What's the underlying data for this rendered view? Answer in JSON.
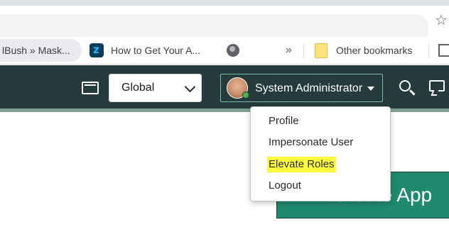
{
  "browser": {
    "bookmarks": [
      {
        "label": "lBush » Mask..."
      },
      {
        "label": "How to Get Your A..."
      },
      {
        "label": ""
      }
    ],
    "more_label": "»",
    "other_bookmarks_label": "Other bookmarks"
  },
  "header": {
    "scope_select_value": "Global",
    "user_name": "System Administrator"
  },
  "user_menu": {
    "items": [
      {
        "label": "Profile",
        "highlighted": false
      },
      {
        "label": "Impersonate User",
        "highlighted": false
      },
      {
        "label": "Elevate Roles",
        "highlighted": true
      },
      {
        "label": "Logout",
        "highlighted": false
      }
    ],
    "highlight_color": "#ffff3b"
  },
  "main": {
    "create_app_label": "Create App"
  },
  "colors": {
    "header_bg": "#263b3c",
    "header_strip": "#7fa293",
    "accent_green": "#1f8a6e"
  }
}
